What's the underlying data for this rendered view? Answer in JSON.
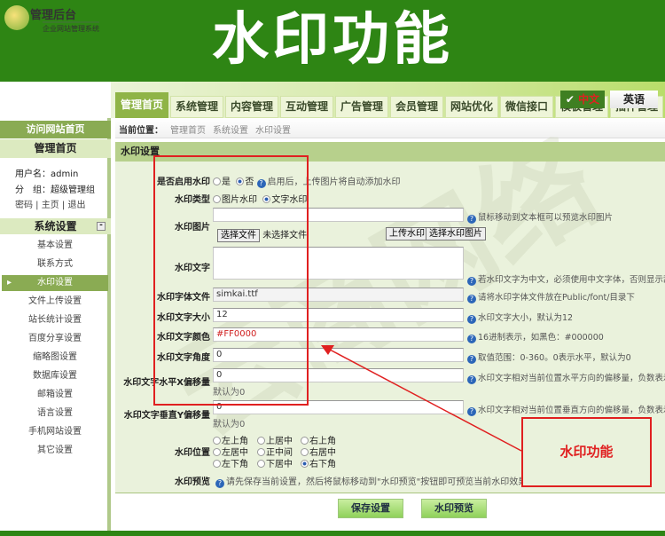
{
  "banner": {
    "title": "水印功能"
  },
  "logo": {
    "title": "管理后台",
    "subtitle": "企业网站管理系统"
  },
  "nav": {
    "tabs": [
      "管理首页",
      "系统管理",
      "内容管理",
      "互动管理",
      "广告管理",
      "会员管理",
      "网站优化",
      "微信接口",
      "模板管理",
      "插件管理"
    ]
  },
  "lang": {
    "zh": "中文",
    "en": "英语"
  },
  "breadcrumb": {
    "label": "当前位置：",
    "items": [
      "管理首页",
      "系统设置",
      "水印设置"
    ]
  },
  "sidebar": {
    "visit": "访问网站首页",
    "home": "管理首页",
    "username": "用户名：admin",
    "group": "分　组：超级管理组",
    "links": [
      "密码",
      "主页",
      "退出"
    ],
    "section": "系统设置",
    "collapse": "-",
    "items": [
      "基本设置",
      "联系方式",
      "水印设置",
      "文件上传设置",
      "站长统计设置",
      "百度分享设置",
      "缩略图设置",
      "数据库设置",
      "邮箱设置",
      "语言设置",
      "手机网站设置",
      "其它设置"
    ]
  },
  "form": {
    "title": "水印设置",
    "enable": {
      "label": "是否启用水印",
      "options": [
        "是",
        "否"
      ],
      "selected": "否",
      "hint": "启用后，上传图片将自动添加水印"
    },
    "type": {
      "label": "水印类型",
      "options": [
        "图片水印",
        "文字水印"
      ],
      "selected": "文字水印"
    },
    "image": {
      "label": "水印图片",
      "value": "",
      "hint": "鼠标移动到文本框可以预览水印图片",
      "choose_file": "选择文件",
      "no_file": "未选择文件",
      "upload": "上传水印",
      "select": "选择水印图片"
    },
    "text": {
      "label": "水印文字",
      "value": "",
      "hint": "若水印文字为中文，必须使用中文字体，否则显示乱码"
    },
    "font": {
      "label": "水印字体文件",
      "value": "simkai.ttf",
      "hint": "请将水印字体文件放在Public/font/目录下"
    },
    "size": {
      "label": "水印文字大小",
      "value": "12",
      "hint": "水印文字大小，默认为12"
    },
    "color": {
      "label": "水印文字颜色",
      "value": "#FF0000",
      "hint": "16进制表示，如黑色：#000000"
    },
    "angle": {
      "label": "水印文字角度",
      "value": "0",
      "hint": "取值范围：0-360。0表示水平，默认为0"
    },
    "offset_x": {
      "label": "水印文字水平X偏移量",
      "value": "0",
      "note": "默认为0",
      "hint": "水印文字相对当前位置水平方向的偏移量，负数表示"
    },
    "offset_y": {
      "label": "水印文字垂直Y偏移量",
      "value": "0",
      "note": "默认为0",
      "hint": "水印文字相对当前位置垂直方向的偏移量，负数表示"
    },
    "position": {
      "label": "水印位置",
      "options": [
        "左上角",
        "上居中",
        "右上角",
        "左居中",
        "正中间",
        "右居中",
        "左下角",
        "下居中",
        "右下角"
      ],
      "selected": "右下角"
    },
    "preview": {
      "label": "水印预览",
      "hint": "请先保存当前设置，然后将鼠标移动到\"水印预览\"按钮即可预览当前水印效果"
    }
  },
  "buttons": {
    "save": "保存设置",
    "preview": "水印预览"
  },
  "annotation": {
    "text": "水印功能",
    "color": "#e02020"
  }
}
